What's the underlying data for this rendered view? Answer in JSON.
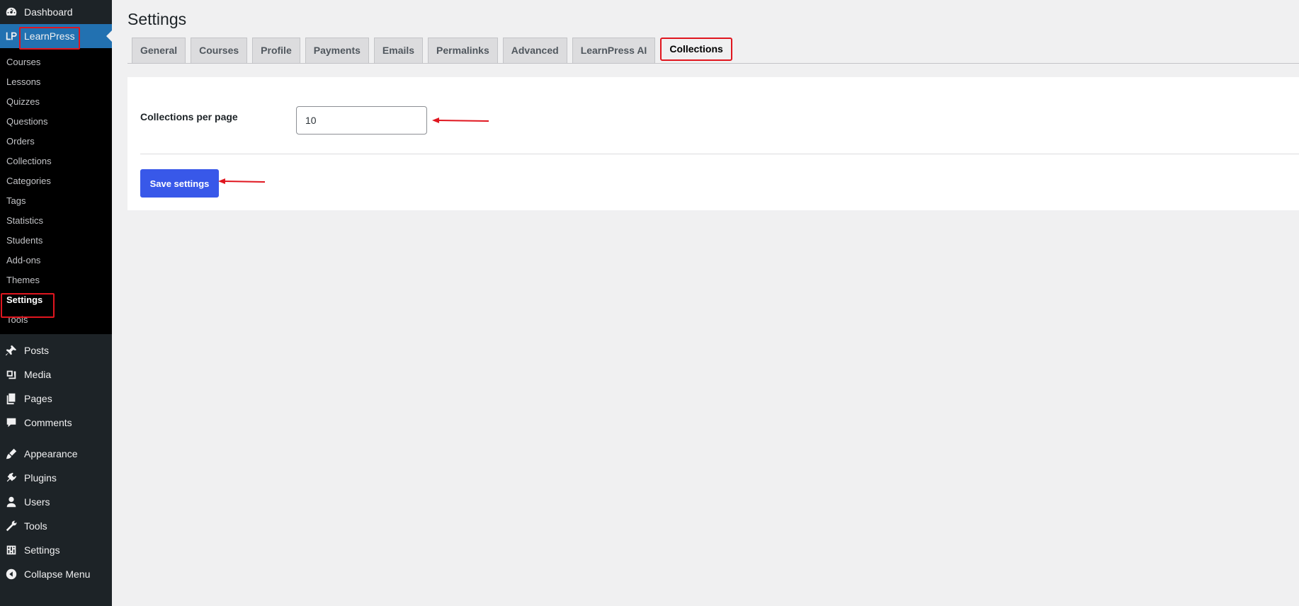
{
  "sidebar": {
    "top_items": [
      {
        "label": "Dashboard",
        "icon": "dashboard-icon"
      },
      {
        "label": "LearnPress",
        "icon": "learnpress-icon"
      }
    ],
    "learnpress_submenu": [
      {
        "label": "Courses"
      },
      {
        "label": "Lessons"
      },
      {
        "label": "Quizzes"
      },
      {
        "label": "Questions"
      },
      {
        "label": "Orders"
      },
      {
        "label": "Collections"
      },
      {
        "label": "Categories"
      },
      {
        "label": "Tags"
      },
      {
        "label": "Statistics"
      },
      {
        "label": "Students"
      },
      {
        "label": "Add-ons"
      },
      {
        "label": "Themes"
      },
      {
        "label": "Settings"
      },
      {
        "label": "Tools"
      }
    ],
    "main_items": [
      {
        "label": "Posts",
        "icon": "pushpin-icon"
      },
      {
        "label": "Media",
        "icon": "media-icon"
      },
      {
        "label": "Pages",
        "icon": "pages-icon"
      },
      {
        "label": "Comments",
        "icon": "comment-icon"
      },
      {
        "label": "Appearance",
        "icon": "brush-icon"
      },
      {
        "label": "Plugins",
        "icon": "plugin-icon"
      },
      {
        "label": "Users",
        "icon": "user-icon"
      },
      {
        "label": "Tools",
        "icon": "wrench-icon"
      },
      {
        "label": "Settings",
        "icon": "settings-icon"
      },
      {
        "label": "Collapse Menu",
        "icon": "collapse-icon"
      }
    ]
  },
  "page": {
    "title": "Settings",
    "tabs": [
      {
        "label": "General"
      },
      {
        "label": "Courses"
      },
      {
        "label": "Profile"
      },
      {
        "label": "Payments"
      },
      {
        "label": "Emails"
      },
      {
        "label": "Permalinks"
      },
      {
        "label": "Advanced"
      },
      {
        "label": "LearnPress AI"
      },
      {
        "label": "Collections"
      }
    ],
    "active_tab": "Collections"
  },
  "form": {
    "collections_per_page_label": "Collections per page",
    "collections_per_page_value": "10",
    "save_label": "Save settings"
  },
  "colors": {
    "sidebar_bg": "#1d2327",
    "submenu_bg": "#000000",
    "current_menu": "#2271b1",
    "save_button": "#3858e9",
    "annotation_red": "#e0161f"
  }
}
